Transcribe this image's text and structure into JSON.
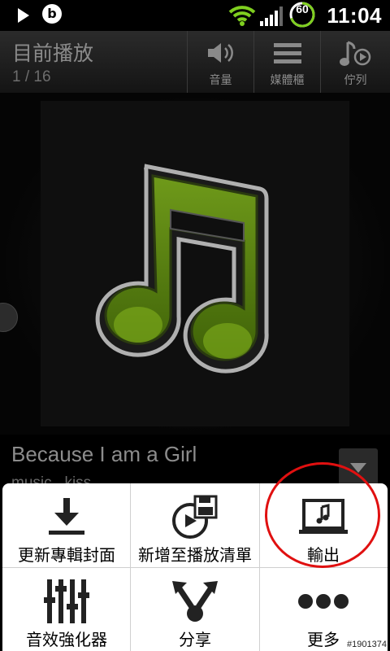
{
  "status_bar": {
    "battery_level": "60",
    "time": "11:04",
    "icons": [
      "play-icon",
      "beats-icon",
      "wifi-icon",
      "signal-icon",
      "battery-icon"
    ]
  },
  "header": {
    "title": "目前播放",
    "track_position": "1 / 16",
    "buttons": [
      {
        "label": "音量",
        "icon": "speaker-icon"
      },
      {
        "label": "媒體櫃",
        "icon": "library-icon"
      },
      {
        "label": "佇列",
        "icon": "queue-icon"
      }
    ]
  },
  "now_playing": {
    "song_title": "Because I am a Girl",
    "artist": "music...kiss",
    "artwork_icon": "music-note-icon",
    "accent_color": "#5a8a10"
  },
  "menu": {
    "items": [
      {
        "label": "更新專輯封面",
        "icon": "download-icon"
      },
      {
        "label": "新增至播放清單",
        "icon": "add-to-playlist-icon"
      },
      {
        "label": "輸出",
        "icon": "output-icon"
      },
      {
        "label": "音效強化器",
        "icon": "equalizer-icon"
      },
      {
        "label": "分享",
        "icon": "share-icon"
      },
      {
        "label": "更多",
        "icon": "more-icon"
      }
    ]
  },
  "watermark": "#1901374"
}
